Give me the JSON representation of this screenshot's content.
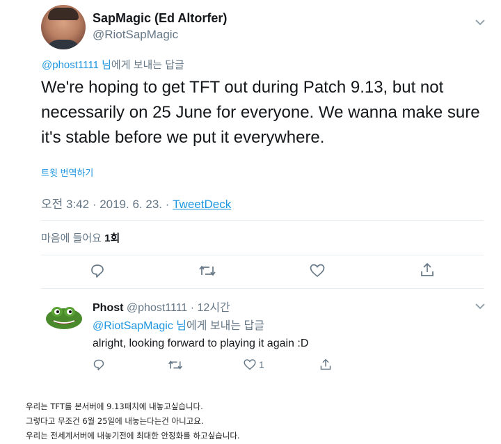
{
  "tweet": {
    "author_name": "SapMagic (Ed Altorfer)",
    "author_handle": "@RiotSapMagic",
    "reply_to_handle": "@phost1111 님",
    "reply_to_suffix": "에게 보내는 답글",
    "text": "We're hoping to get TFT out during Patch 9.13, but not necessarily on 25 June for everyone. We wanna make sure it's stable before we put it everywhere.",
    "translate_label": "트윗 번역하기",
    "timestamp": "오전 3:42 · 2019. 6. 23. · ",
    "source": "TweetDeck",
    "likes_label": "마음에 들어요 ",
    "likes_count": "1회"
  },
  "reply": {
    "author_name": "Phost",
    "author_handle": " @phost1111 · 12시간",
    "reply_to_handle": "@RiotSapMagic 님",
    "reply_to_suffix": "에게 보내는 답글",
    "text": "alright, looking forward to playing it again :D",
    "like_count": "1"
  },
  "caption": [
    "우리는 TFT를 본서버에 9.13패치에 내놓고싶습니다.",
    "그렇다고 무조건 6월 25일에 내놓는다는건 아니고요.",
    "우리는 전세계서버에 내놓기전에 최대한 안정화를 하고싶습니다."
  ],
  "icons": {
    "tweet_actions": [
      "reply-icon",
      "retweet-icon",
      "like-icon",
      "share-icon"
    ],
    "menu": "chevron-down-icon"
  },
  "colors": {
    "link": "#1b95e0",
    "secondary_text": "#657786",
    "icon": "#657786",
    "divider": "#e6ecf0"
  }
}
